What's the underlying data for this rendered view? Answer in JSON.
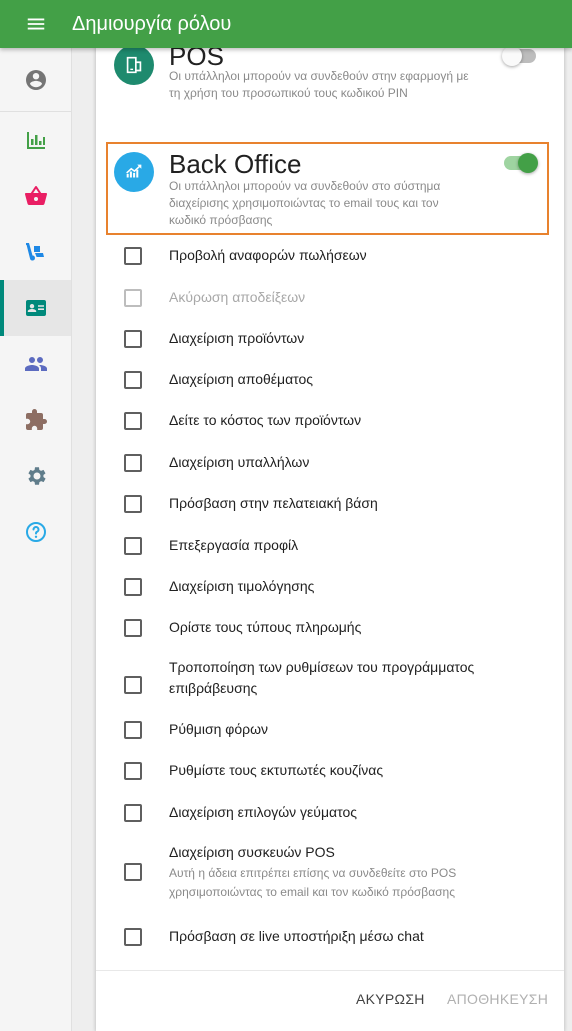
{
  "appbar": {
    "title": "Δημιουργία ρόλου"
  },
  "sidenav": {
    "items": [
      {
        "name": "reports",
        "icon": "bar-chart-icon"
      },
      {
        "name": "items",
        "icon": "basket-icon"
      },
      {
        "name": "inventory",
        "icon": "hand-truck-icon"
      },
      {
        "name": "employees",
        "icon": "badge-icon",
        "active": true
      },
      {
        "name": "customers",
        "icon": "people-icon"
      },
      {
        "name": "integrations",
        "icon": "puzzle-icon"
      },
      {
        "name": "settings",
        "icon": "gear-icon"
      },
      {
        "name": "help",
        "icon": "help-icon"
      }
    ]
  },
  "pos": {
    "title": "POS",
    "description": "Οι υπάλληλοι μπορούν να συνδεθούν στην εφαρμογή με τη χρήση του προσωπικού τους κωδικού PIN",
    "enabled": false
  },
  "backoffice": {
    "title": "Back Office",
    "description": "Οι υπάλληλοι μπορούν να συνδεθούν στο σύστημα διαχείρισης χρησιμοποιώντας το email τους και τον κωδικό πρόσβασης",
    "enabled": true
  },
  "permissions": [
    {
      "label": "Προβολή αναφορών πωλήσεων",
      "checked": false
    },
    {
      "label": "Ακύρωση αποδείξεων",
      "checked": false,
      "disabled": true
    },
    {
      "label": "Διαχείριση προϊόντων",
      "checked": false
    },
    {
      "label": "Διαχείριση αποθέματος",
      "checked": false
    },
    {
      "label": "Δείτε το κόστος των προϊόντων",
      "checked": false
    },
    {
      "label": "Διαχείριση υπαλλήλων",
      "checked": false
    },
    {
      "label": "Πρόσβαση στην πελατειακή βάση",
      "checked": false
    },
    {
      "label": "Επεξεργασία προφίλ",
      "checked": false
    },
    {
      "label": "Διαχείριση τιμολόγησης",
      "checked": false
    },
    {
      "label": "Ορίστε τους τύπους πληρωμής",
      "checked": false
    },
    {
      "label_line1": "Τροποποίηση των ρυθμίσεων του προγράμματος",
      "label_line2": "επιβράβευσης",
      "checked": false
    },
    {
      "label": "Ρύθμιση φόρων",
      "checked": false
    },
    {
      "label": "Ρυθμίστε τους εκτυπωτές κουζίνας",
      "checked": false
    },
    {
      "label": "Διαχείριση επιλογών γεύματος",
      "checked": false
    },
    {
      "label": "Διαχείριση συσκευών POS",
      "sub_line1": "Αυτή η άδεια επιτρέπει επίσης να συνδεθείτε στο POS",
      "sub_line2": "χρησιμοποιώντας το email και τον κωδικό πρόσβασης",
      "checked": false
    },
    {
      "label": "Πρόσβαση σε live υποστήριξη μέσω chat",
      "checked": false
    }
  ],
  "footer": {
    "cancel": "ΑΚΥΡΩΣΗ",
    "save": "ΑΠΟΘΗΚΕΥΣΗ"
  },
  "colors": {
    "appbar": "#43a047",
    "highlight": "#e8822e",
    "pos_icon": "#1e8a6e",
    "backoffice_icon": "#29a9e6",
    "toggle_on": "#43a047"
  }
}
